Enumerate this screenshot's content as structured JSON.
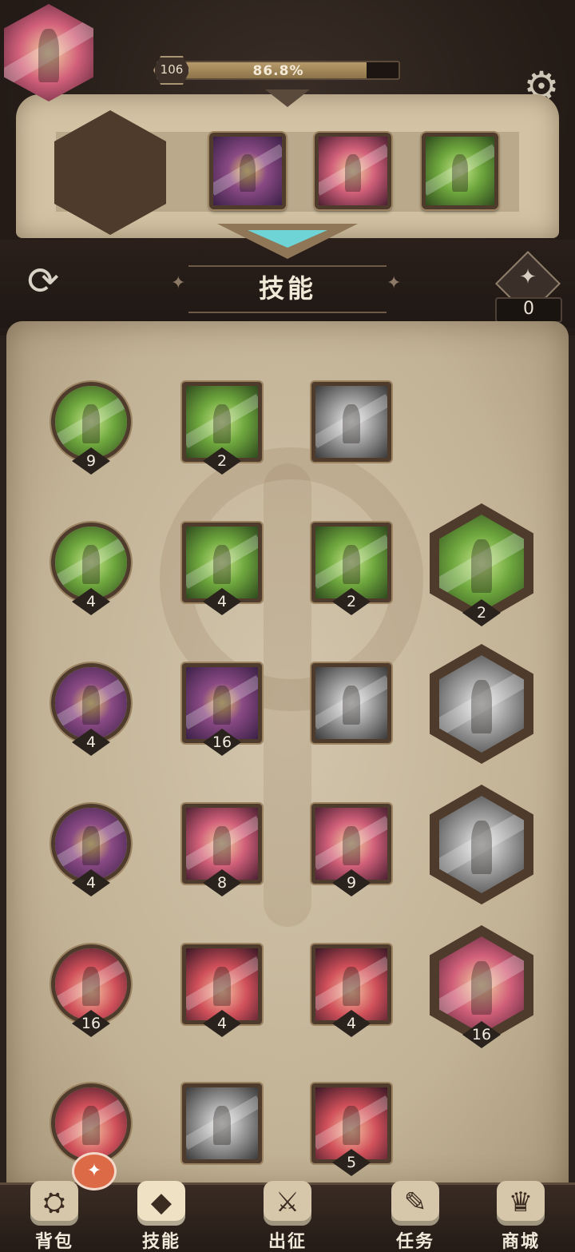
{
  "header": {
    "level": "106",
    "exp_percent_text": "86.8%",
    "exp_fraction": 0.868,
    "settings_icon": "gear-icon"
  },
  "equipped": {
    "main_skill": {
      "art": "pink"
    },
    "slots": [
      {
        "art": "purple"
      },
      {
        "art": "pink"
      },
      {
        "art": "green"
      }
    ]
  },
  "section": {
    "title": "技能",
    "points": "0",
    "swap_icon": "swap-icon",
    "points_icon": "star-gem-icon"
  },
  "skills": [
    {
      "shape": "round",
      "art": "green",
      "count": "9"
    },
    {
      "shape": "square",
      "art": "green",
      "count": "2"
    },
    {
      "shape": "square",
      "art": "gray",
      "count": ""
    },
    {
      "shape": "round",
      "art": "green",
      "count": "4"
    },
    {
      "shape": "square",
      "art": "green",
      "count": "4"
    },
    {
      "shape": "square",
      "art": "green",
      "count": "2"
    },
    {
      "shape": "hex",
      "art": "green",
      "count": "2"
    },
    {
      "shape": "round",
      "art": "purple",
      "count": "4"
    },
    {
      "shape": "square",
      "art": "purple",
      "count": "16"
    },
    {
      "shape": "square",
      "art": "gray",
      "count": ""
    },
    {
      "shape": "hex",
      "art": "gray",
      "count": ""
    },
    {
      "shape": "round",
      "art": "purple",
      "count": "4"
    },
    {
      "shape": "square",
      "art": "pink",
      "count": "8"
    },
    {
      "shape": "square",
      "art": "pink",
      "count": "9"
    },
    {
      "shape": "hex",
      "art": "gray",
      "count": ""
    },
    {
      "shape": "round",
      "art": "red",
      "count": "16"
    },
    {
      "shape": "square",
      "art": "red",
      "count": "4"
    },
    {
      "shape": "square",
      "art": "red",
      "count": "4"
    },
    {
      "shape": "hex",
      "art": "pink",
      "count": "16"
    },
    {
      "shape": "round",
      "art": "red",
      "count": ""
    },
    {
      "shape": "square",
      "art": "gray",
      "count": ""
    },
    {
      "shape": "square",
      "art": "red",
      "count": "5"
    }
  ],
  "nav": {
    "items": [
      {
        "label": "背包",
        "icon": "backpack-icon",
        "glyph": "⛭"
      },
      {
        "label": "技能",
        "icon": "skill-book-icon",
        "glyph": "◆"
      },
      {
        "label": "出征",
        "icon": "sword-map-icon",
        "glyph": "⚔"
      },
      {
        "label": "任务",
        "icon": "scroll-icon",
        "glyph": "✎"
      },
      {
        "label": "商城",
        "icon": "crown-shop-icon",
        "glyph": "♛"
      }
    ],
    "active_index": 1,
    "badge_icon": "notification-badge-icon",
    "badge_glyph": "✦"
  }
}
